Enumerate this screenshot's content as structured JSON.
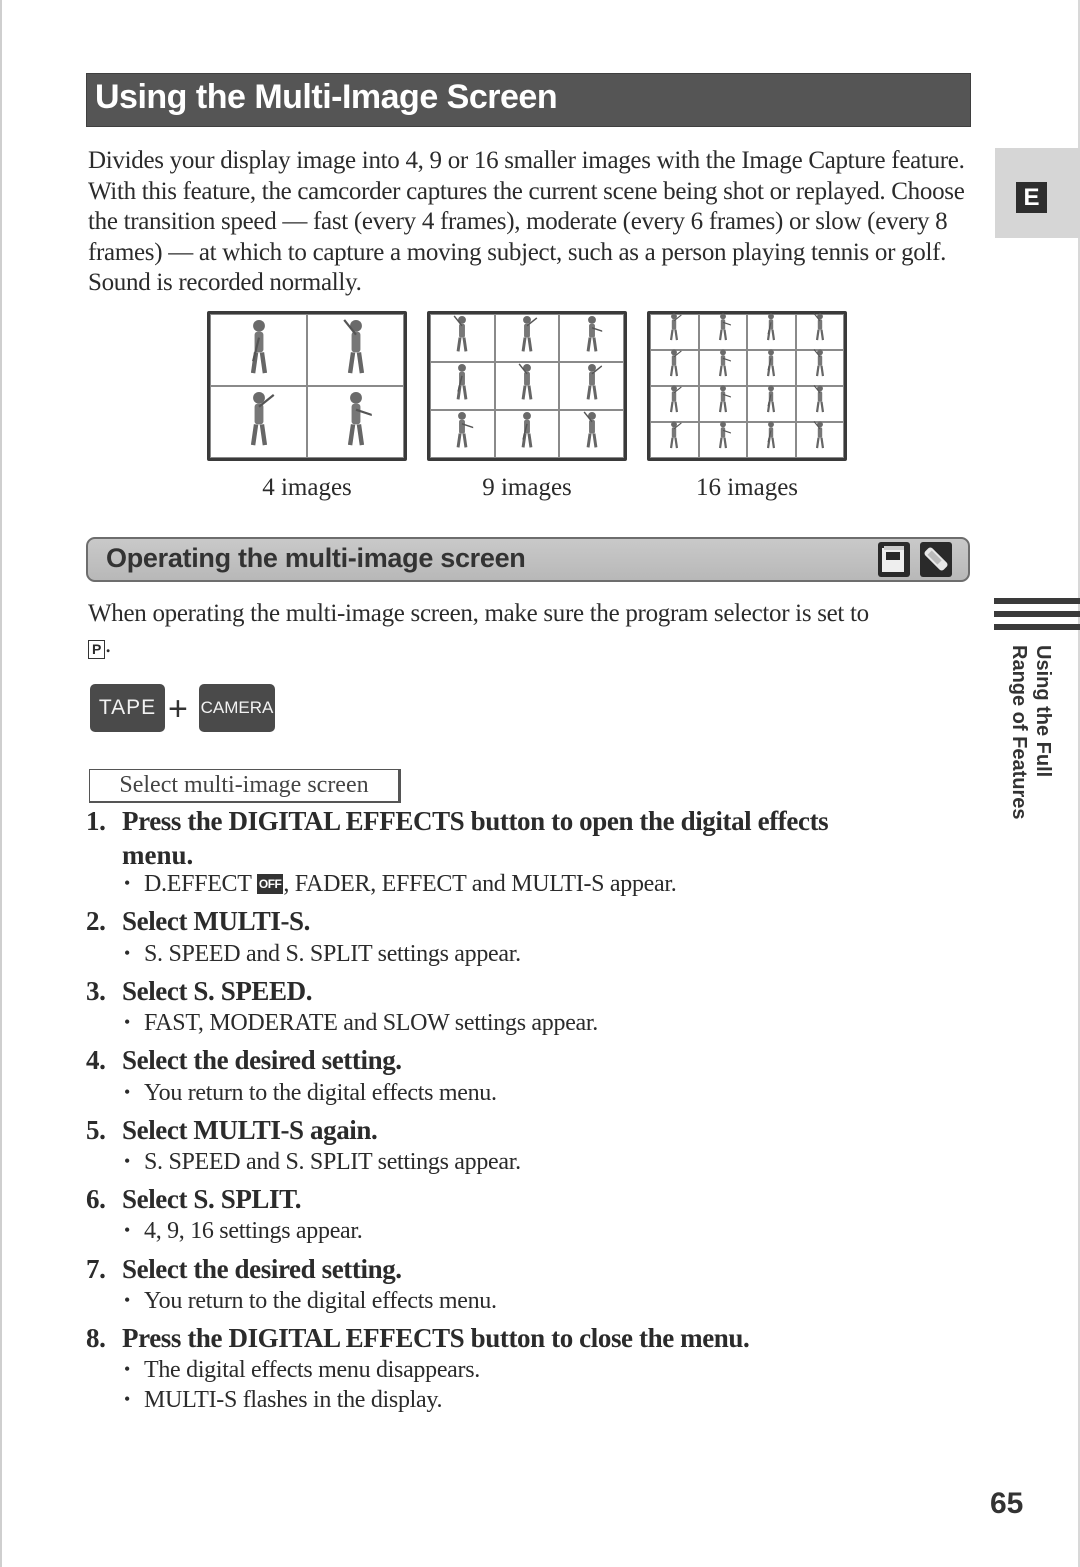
{
  "page": {
    "title": "Using the Multi-Image Screen",
    "language_tab": "E",
    "page_number": "65",
    "side_tab": {
      "line1": "Using the Full",
      "line2": "Range of Features"
    }
  },
  "intro": "Divides your display image into 4, 9 or 16 smaller images with the Image Capture feature. With this feature, the camcorder captures the current scene being shot or replayed. Choose the transition speed — fast (every 4 frames), moderate (every 6 frames) or slow (every 8 frames) — at which to capture a moving subject, such as a person playing tennis or golf. Sound is recorded normally.",
  "illustrations": [
    {
      "caption": "4 images",
      "cells": 4
    },
    {
      "caption": "9 images",
      "cells": 9
    },
    {
      "caption": "16 images",
      "cells": 16
    }
  ],
  "section": {
    "title": "Operating the multi-image screen",
    "icons": [
      "cassette-mode-icon",
      "pen-mode-icon"
    ],
    "note": "When operating the multi-image screen, make sure the program selector is set to",
    "note_glyph": "P",
    "note_end": "."
  },
  "mode": {
    "key1": "TAPE",
    "plus": "+",
    "key2": "CAMERA",
    "label": "Select multi-image screen"
  },
  "steps": [
    {
      "num": "1.",
      "title": "Press the DIGITAL EFFECTS button to open the digital effects",
      "title_cont": "menu.",
      "bullets": [
        {
          "pre": "D.EFFECT",
          "badge": "OFF",
          "post": ", FADER, EFFECT and MULTI-S appear."
        }
      ]
    },
    {
      "num": "2.",
      "title": "Select MULTI-S.",
      "bullets": [
        {
          "text": "S. SPEED and S. SPLIT settings appear."
        }
      ]
    },
    {
      "num": "3.",
      "title": "Select S. SPEED.",
      "bullets": [
        {
          "text": "FAST, MODERATE and SLOW settings appear."
        }
      ]
    },
    {
      "num": "4.",
      "title": "Select the desired setting.",
      "bullets": [
        {
          "text": "You return to the digital effects menu."
        }
      ]
    },
    {
      "num": "5.",
      "title": "Select MULTI-S again.",
      "bullets": [
        {
          "text": "S. SPEED and S. SPLIT settings appear."
        }
      ]
    },
    {
      "num": "6.",
      "title": "Select S. SPLIT.",
      "bullets": [
        {
          "text": "4, 9, 16 settings appear."
        }
      ]
    },
    {
      "num": "7.",
      "title": "Select the desired setting.",
      "bullets": [
        {
          "text": "You return to the digital effects menu."
        }
      ]
    },
    {
      "num": "8.",
      "title": "Press the DIGITAL EFFECTS button to close the menu.",
      "bullets": [
        {
          "text": "The digital effects menu disappears."
        },
        {
          "text": "MULTI-S flashes in the display."
        }
      ]
    }
  ]
}
